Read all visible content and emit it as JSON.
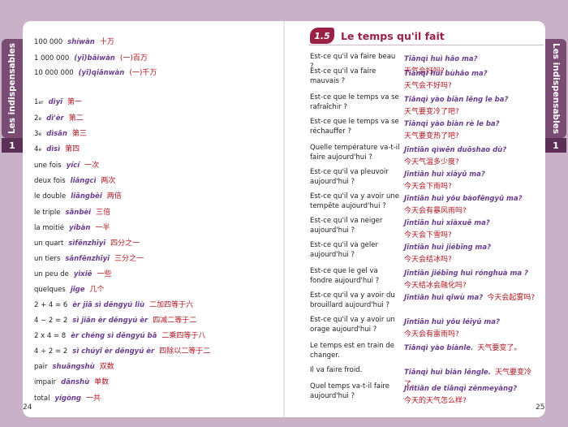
{
  "tab": {
    "label": "Les indispensables",
    "number": "1"
  },
  "page_left": {
    "number": "24",
    "rows": [
      {
        "fr": "100 000",
        "pin": "shíwàn",
        "zh": "十万"
      },
      {
        "fr": "1 000 000",
        "pin": "(yī)bǎiwàn",
        "zh": "(一)百万"
      },
      {
        "fr": "10 000 000",
        "pin": "(yī)qiānwàn",
        "zh": "(一)千万"
      },
      {
        "fr": "1",
        "sup": "er",
        "pin": "dìyī",
        "zh": "第一"
      },
      {
        "fr": "2",
        "sup": "e",
        "pin": "dì'èr",
        "zh": "第二"
      },
      {
        "fr": "3",
        "sup": "e",
        "pin": "dìsān",
        "zh": "第三"
      },
      {
        "fr": "4",
        "sup": "e",
        "pin": "dìsì",
        "zh": "第四"
      },
      {
        "fr": "une fois",
        "pin": "yící",
        "zh": "一次"
      },
      {
        "fr": "deux fois",
        "pin": "liǎngcì",
        "zh": "两次"
      },
      {
        "fr": "le double",
        "pin": "liǎngbèi",
        "zh": "两倍"
      },
      {
        "fr": "le triple",
        "pin": "sānbèi",
        "zh": "三倍"
      },
      {
        "fr": "la moitié",
        "pin": "yíbàn",
        "zh": "一半"
      },
      {
        "fr": "un quart",
        "pin": "sìfēnzhīyī",
        "zh": "四分之一"
      },
      {
        "fr": "un tiers",
        "pin": "sānfēnzhīyī",
        "zh": "三分之一"
      },
      {
        "fr": "un peu de",
        "pin": "yìxiē",
        "zh": "一些"
      },
      {
        "fr": "quelques",
        "pin": "jǐge",
        "zh": "几个"
      },
      {
        "fr": "2 + 4 = 6",
        "pin": "èr jiā sì děngyú liù",
        "zh": "二加四等于六"
      },
      {
        "fr": "4 − 2 = 2",
        "pin": "sì jiǎn èr děngyú èr",
        "zh": "四减二等于二"
      },
      {
        "fr": "2 x 4 = 8",
        "pin": "èr chéng sì děngyú bā",
        "zh": "二乘四等于八"
      },
      {
        "fr": "4 ÷ 2 = 2",
        "pin": "sì chúyǐ èr děngyú èr",
        "zh": "四除以二等于二"
      },
      {
        "fr": "pair",
        "pin": "shuāngshù",
        "zh": "双数"
      },
      {
        "fr": "impair",
        "pin": "dānshù",
        "zh": "单数"
      },
      {
        "fr": "total",
        "pin": "yígòng",
        "zh": "一共"
      }
    ]
  },
  "page_right": {
    "number": "25",
    "section_number": "1.5",
    "section_title": "Le temps qu'il fait",
    "rows": [
      {
        "q": "Est-ce qu'il va faire beau ?",
        "pin": "Tiānqì huì hǎo ma?",
        "zh": "天气会好吗?"
      },
      {
        "q": "Est-ce qu'il va faire mauvais ?",
        "pin": "Tiānqì huì bùhǎo ma?",
        "zh": "天气会不好吗?"
      },
      {
        "q": "Est-ce que le temps va se rafraîchir ?",
        "pin": "Tiānqì yào biàn lěng le ba?",
        "zh": "天气要变冷了吧?"
      },
      {
        "q": "Est-ce que le temps va se réchauffer ?",
        "pin": "Tiānqì yào biàn rè le ba?",
        "zh": "天气要变热了吧?"
      },
      {
        "q": "Quelle température va-t-il faire aujourd'hui ?",
        "pin": "Jīntiān qìwēn duōshao dù?",
        "zh": "今天气温多少度?"
      },
      {
        "q": "Est-ce qu'il va pleuvoir aujourd'hui ?",
        "pin": "Jīntiān huì xiàyǔ ma?",
        "zh": "今天会下雨吗?"
      },
      {
        "q": "Est-ce qu'il va y avoir une tempête aujourd'hui ?",
        "pin": "Jīntiān huì yǒu bàofēngyǔ ma?",
        "zh": "今天会有暴风雨吗?"
      },
      {
        "q": "Est-ce qu'il va neiger aujourd'hui ?",
        "pin": "Jīntiān huì xiàxuě ma?",
        "zh": "今天会下雪吗?"
      },
      {
        "q": "Est-ce qu'il va geler aujourd'hui ?",
        "pin": "Jīntiān huì jiébīng ma?",
        "zh": "今天会结冰吗?"
      },
      {
        "q": "Est-ce que le gel va fondre aujourd'hui ?",
        "pin": "Jīntiān jiébīng huì rónghuà ma ?",
        "zh": "今天结冰会融化吗?"
      },
      {
        "q": "Est-ce qu'il va y avoir du brouillard aujourd'hui ?",
        "pin": "Jīntiān huì qǐwù ma?",
        "zh": "今天会起雾吗?",
        "inline": true
      },
      {
        "q": "Est-ce qu'il va y avoir un orage aujourd'hui ?",
        "pin": "Jīntiān huì yǒu léiyǔ ma?",
        "zh": "今天会有雷雨吗?"
      },
      {
        "q": "Le temps est en train de changer.",
        "pin": "Tiānqì yào biànle.",
        "zh": "天气要变了。",
        "inline": true
      },
      {
        "q": "Il va faire froid.",
        "pin": "Tiānqì huì biàn lěngle.",
        "zh": "天气要变冷了。",
        "inline": true
      },
      {
        "q": "Quel temps va-t-il faire aujourd'hui ?",
        "pin": "Jīntiān de tiānqì zěnmeyàng?",
        "zh": "今天的天气怎么样?"
      }
    ]
  }
}
